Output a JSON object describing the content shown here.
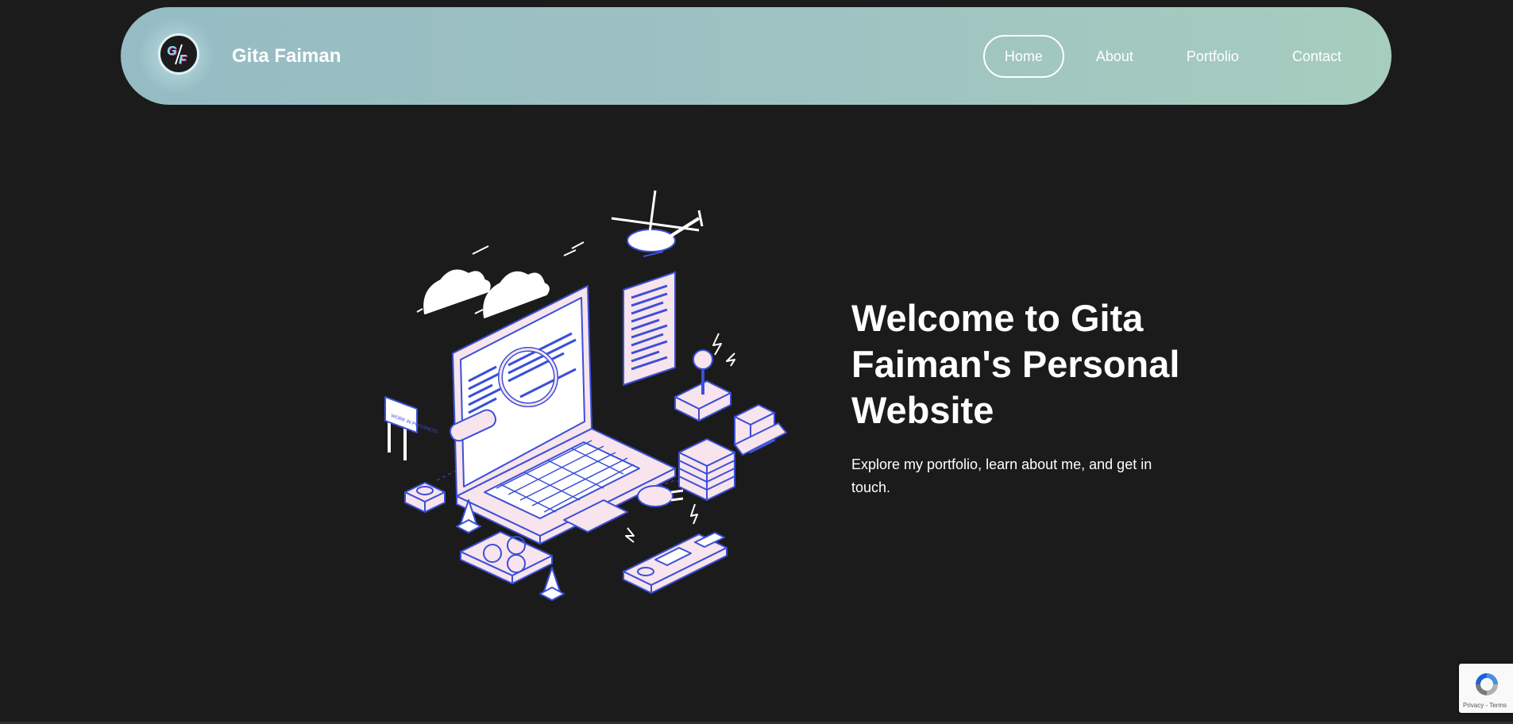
{
  "header": {
    "logo_text": "G/F",
    "brand": "Gita Faiman",
    "nav": [
      {
        "label": "Home",
        "active": true
      },
      {
        "label": "About",
        "active": false
      },
      {
        "label": "Portfolio",
        "active": false
      },
      {
        "label": "Contact",
        "active": false
      }
    ]
  },
  "hero": {
    "title": "Welcome to Gita Faiman's Personal Website",
    "subtitle": "Explore my portfolio, learn about me, and get in touch.",
    "illustration_sign": "WORK IN PROGRESS"
  },
  "recaptcha": {
    "privacy": "Privacy",
    "separator": "-",
    "terms": "Terms"
  },
  "colors": {
    "background": "#1b1b1b",
    "navbar_start": "#95bcc3",
    "navbar_end": "#a6cdbe",
    "illustration_fill": "#f7e4ec",
    "illustration_stroke": "#3b4fd8"
  }
}
